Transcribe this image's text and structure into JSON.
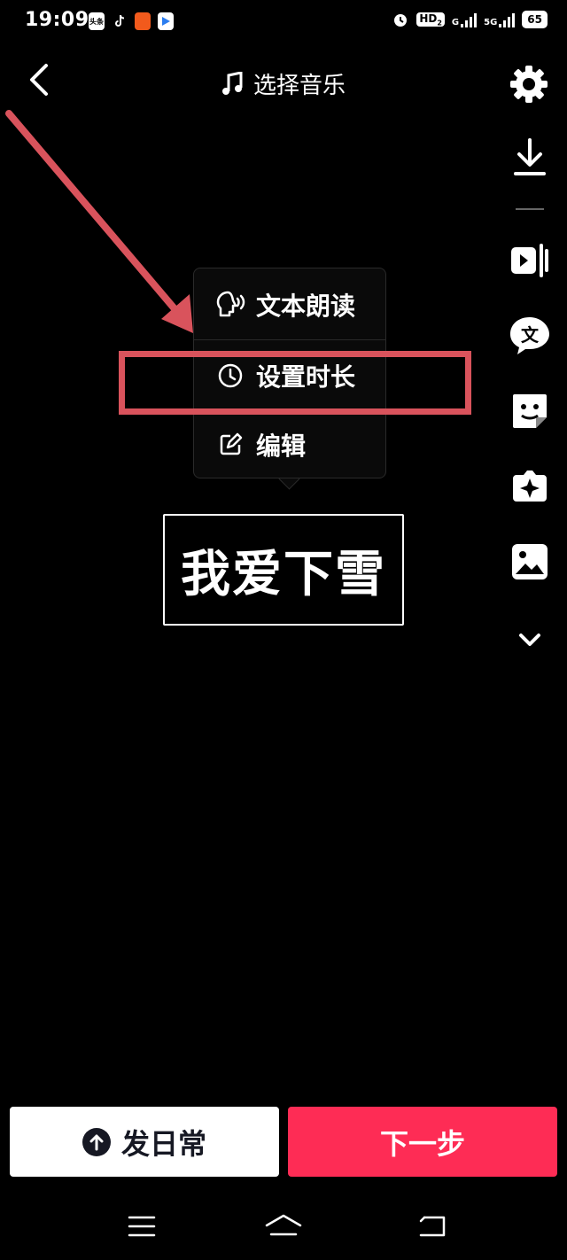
{
  "status_bar": {
    "time": "19:09",
    "app_icons": [
      "toutiao-icon",
      "tiktok-icon",
      "weibo-icon",
      "video-app-icon"
    ],
    "hd_label": "HD",
    "hd_sub": "2",
    "g_label": "G",
    "fiveg_label": "5G",
    "battery": "65"
  },
  "header": {
    "title": "选择音乐"
  },
  "side_tools": [
    "settings-icon",
    "download-icon",
    "clip-icon",
    "text-icon",
    "sticker-icon",
    "effect-icon",
    "image-icon",
    "expand-icon"
  ],
  "popup_menu": {
    "items": [
      {
        "label": "文本朗读",
        "icon": "voice-read-icon"
      },
      {
        "label": "设置时长",
        "icon": "clock-icon"
      },
      {
        "label": "编辑",
        "icon": "edit-icon"
      }
    ]
  },
  "canvas": {
    "text": "我爱下雪"
  },
  "footer": {
    "daily_label": "发日常",
    "next_label": "下一步"
  },
  "colors": {
    "background": "#000000",
    "accent": "#fe2c55",
    "annotation": "#d9535c"
  }
}
